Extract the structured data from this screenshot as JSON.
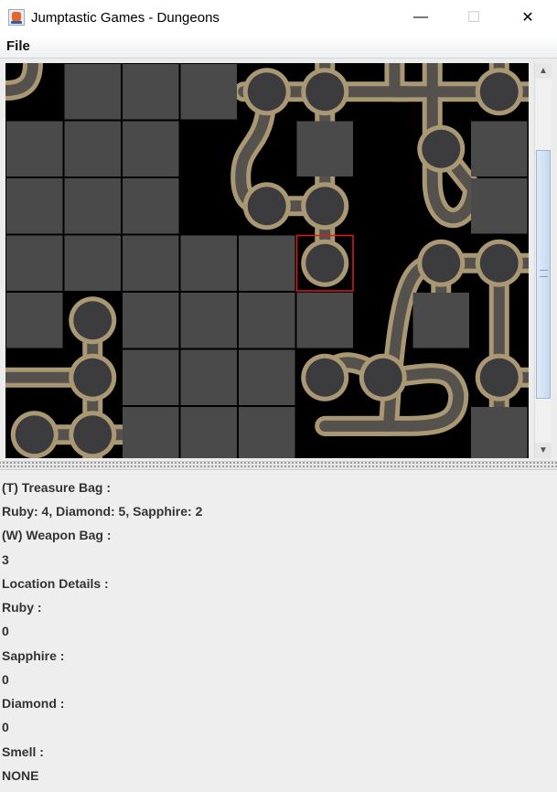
{
  "window": {
    "title": "Jumptastic Games - Dungeons",
    "minimize_glyph": "—",
    "maximize_glyph": "☐",
    "close_glyph": "✕"
  },
  "menu": {
    "file_label": "File"
  },
  "board": {
    "columns": 9,
    "rows": 7,
    "colors": {
      "wall_tile": "#4a4a4a",
      "background": "#000000",
      "path_outer": "#a99873",
      "path_inner": "#55524e",
      "node_fill": "#3c3c3e",
      "selection": "#e01b1b"
    },
    "wall_cells": [
      [
        1,
        0
      ],
      [
        2,
        0
      ],
      [
        3,
        0
      ],
      [
        0,
        1
      ],
      [
        1,
        1
      ],
      [
        2,
        1
      ],
      [
        5,
        1
      ],
      [
        8,
        1
      ],
      [
        0,
        2
      ],
      [
        1,
        2
      ],
      [
        2,
        2
      ],
      [
        8,
        2
      ],
      [
        0,
        3
      ],
      [
        1,
        3
      ],
      [
        2,
        3
      ],
      [
        3,
        3
      ],
      [
        4,
        3
      ],
      [
        0,
        4
      ],
      [
        2,
        4
      ],
      [
        3,
        4
      ],
      [
        4,
        4
      ],
      [
        5,
        4
      ],
      [
        7,
        4
      ],
      [
        2,
        5
      ],
      [
        3,
        5
      ],
      [
        4,
        5
      ],
      [
        2,
        6
      ],
      [
        3,
        6
      ],
      [
        4,
        6
      ],
      [
        8,
        6
      ]
    ],
    "room_nodes": [
      [
        4,
        0
      ],
      [
        5,
        0
      ],
      [
        8,
        0
      ],
      [
        7,
        1
      ],
      [
        4,
        2
      ],
      [
        5,
        2
      ],
      [
        5,
        3
      ],
      [
        7,
        3
      ],
      [
        8,
        3
      ],
      [
        1,
        4
      ],
      [
        1,
        5
      ],
      [
        5,
        5
      ],
      [
        6,
        5
      ],
      [
        8,
        5
      ],
      [
        0,
        6
      ],
      [
        1,
        6
      ]
    ],
    "selected_cell": [
      5,
      3
    ]
  },
  "info": {
    "treasure_label": "(T) Treasure Bag :",
    "treasure_value": "Ruby: 4, Diamond: 5, Sapphire: 2",
    "weapon_label": "(W) Weapon Bag :",
    "weapon_value": "3",
    "location_label": "Location Details :",
    "ruby_label": "Ruby :",
    "ruby_value": "0",
    "sapphire_label": "Sapphire :",
    "sapphire_value": "0",
    "diamond_label": "Diamond :",
    "diamond_value": "0",
    "smell_label": "Smell :",
    "smell_value": "NONE"
  }
}
